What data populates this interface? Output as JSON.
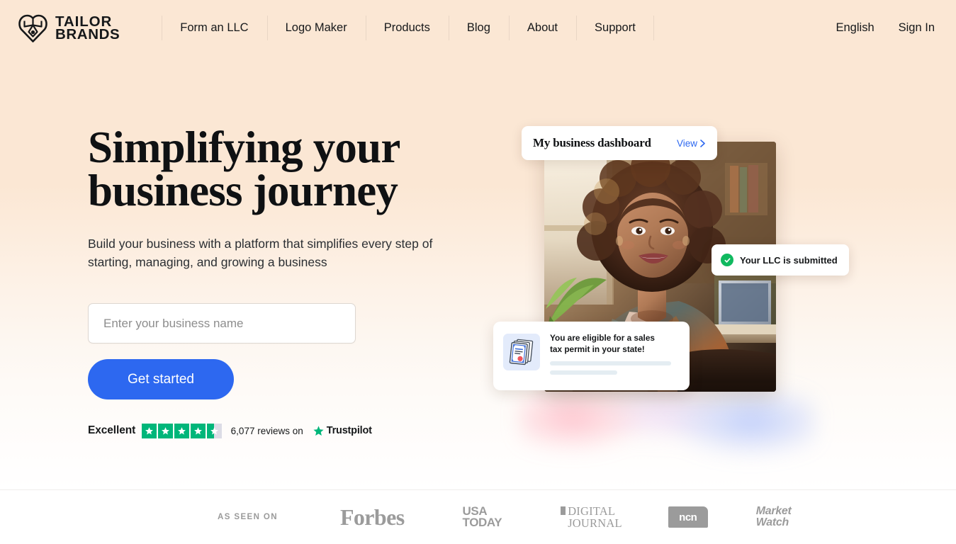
{
  "brand": {
    "name_line1": "TAILOR",
    "name_line2": "BRANDS",
    "logo_icon": "tailor-brands-heart-icon",
    "accent_blue": "#2d68f0",
    "bg_peach": "#fbe7d4",
    "trust_green": "#00b67a",
    "success_green": "#10b95f"
  },
  "nav": {
    "items": [
      {
        "label": "Form an LLC"
      },
      {
        "label": "Logo Maker"
      },
      {
        "label": "Products"
      },
      {
        "label": "Blog"
      },
      {
        "label": "About"
      },
      {
        "label": "Support"
      }
    ],
    "language": "English",
    "sign_in": "Sign In"
  },
  "hero": {
    "headline_line1": "Simplifying your",
    "headline_line2": "business journey",
    "subhead": "Build your business with a platform that simplifies every step of starting, managing, and growing a business",
    "input_placeholder": "Enter your business name",
    "input_value": "",
    "cta_label": "Get started"
  },
  "trustpilot": {
    "rating_word": "Excellent",
    "stars_total": 5,
    "stars_filled": 4,
    "has_half_star": true,
    "reviews_text": "6,077 reviews on",
    "brand_name": "Trustpilot",
    "star_icon": "star-icon",
    "brand_star_icon": "trustpilot-star-icon"
  },
  "visual": {
    "photo_alt": "smiling-woman-in-office-photo",
    "dashboard_chip": {
      "title": "My business dashboard",
      "view_label": "View",
      "chevron_icon": "chevron-right-icon"
    },
    "llc_chip": {
      "text": "Your LLC is submitted",
      "icon": "check-circle-icon"
    },
    "tax_card": {
      "icon": "certificate-document-icon",
      "title_line1": "You are eligible for a sales",
      "title_line2": "tax permit in your state!"
    }
  },
  "press": {
    "label": "AS SEEN ON",
    "logos": [
      {
        "name": "forbes-logo",
        "text": "Forbes"
      },
      {
        "name": "usa-today-logo",
        "line1": "USA",
        "line2": "TODAY"
      },
      {
        "name": "digital-journal-logo",
        "line1": "DIGITAL",
        "line2": "JOURNAL"
      },
      {
        "name": "ncn-logo",
        "text": "ncn"
      },
      {
        "name": "marketwatch-logo",
        "line1": "Market",
        "line2": "Watch"
      }
    ]
  }
}
